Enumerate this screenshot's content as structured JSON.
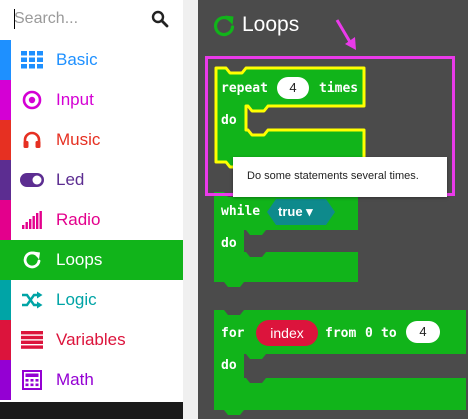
{
  "search": {
    "placeholder": "Search..."
  },
  "categories": [
    {
      "label": "Basic",
      "icon": "grid-icon",
      "color": "#1e90ff"
    },
    {
      "label": "Input",
      "icon": "target-icon",
      "color": "#d400d4"
    },
    {
      "label": "Music",
      "icon": "headphones-icon",
      "color": "#e63022"
    },
    {
      "label": "Led",
      "icon": "toggle-icon",
      "color": "#5c2d91"
    },
    {
      "label": "Radio",
      "icon": "signal-bars-icon",
      "color": "#e3008c"
    },
    {
      "label": "Loops",
      "icon": "refresh-icon",
      "color": "#11b41a",
      "selected": true
    },
    {
      "label": "Logic",
      "icon": "shuffle-icon",
      "color": "#00a4a6"
    },
    {
      "label": "Variables",
      "icon": "list-icon",
      "color": "#dc143c"
    },
    {
      "label": "Math",
      "icon": "calculator-icon",
      "color": "#9400d3"
    }
  ],
  "flyout": {
    "title": "Loops",
    "repeat_block": {
      "kw_repeat": "repeat",
      "count": "4",
      "kw_times": "times",
      "kw_do": "do"
    },
    "while_block": {
      "kw_while": "while",
      "condition": "true ▾",
      "kw_do": "do"
    },
    "for_block": {
      "kw_for": "for",
      "variable": "index",
      "kw_from": "from",
      "from_value": "0",
      "kw_to": "to",
      "to_value": "4",
      "kw_do": "do"
    },
    "tooltip": "Do some statements several times."
  },
  "colors": {
    "loops_green": "#11b41a",
    "highlight_magenta": "#ea3aea",
    "workspace": "#4b4b4b"
  }
}
